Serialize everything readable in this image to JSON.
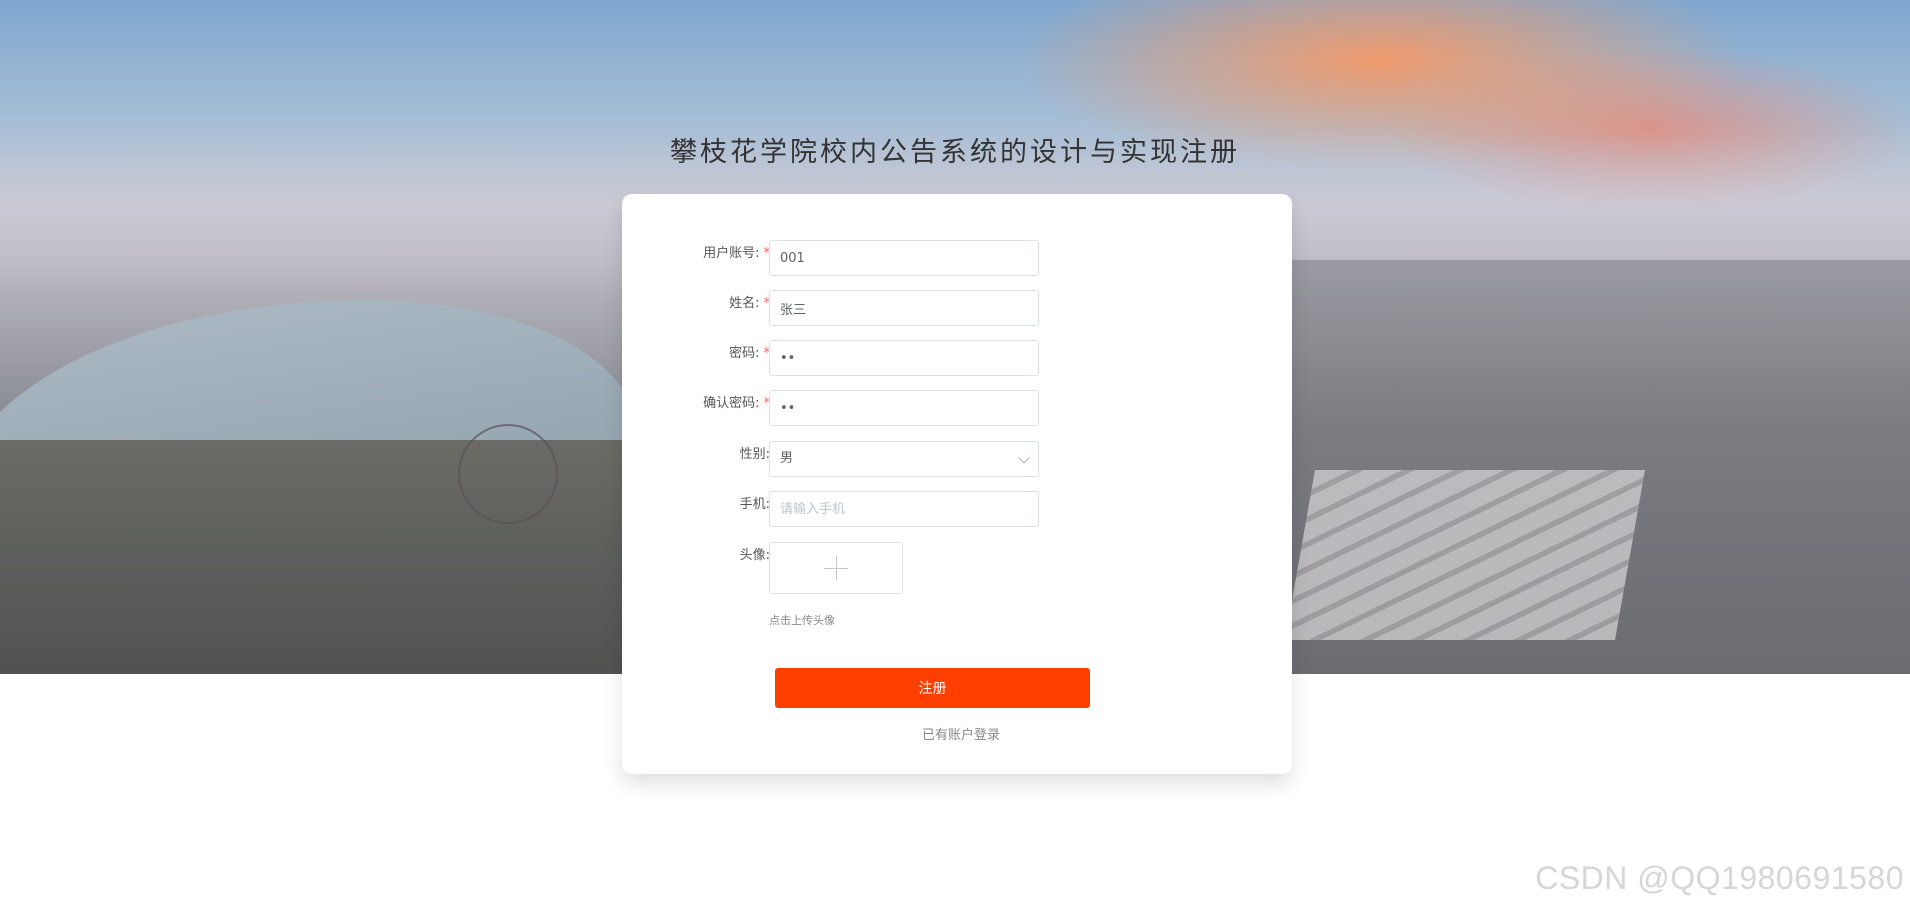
{
  "page": {
    "title": "攀枝花学院校内公告系统的设计与实现注册"
  },
  "form": {
    "fields": [
      {
        "label": "用户账号:",
        "required": true,
        "value": "001",
        "placeholder": ""
      },
      {
        "label": "姓名:",
        "required": true,
        "value": "张三",
        "placeholder": ""
      },
      {
        "label": "密码:",
        "required": true,
        "value": "••",
        "placeholder": ""
      },
      {
        "label": "确认密码:",
        "required": true,
        "value": "••",
        "placeholder": ""
      },
      {
        "label": "性别:",
        "required": false,
        "value": "男",
        "placeholder": ""
      },
      {
        "label": "手机:",
        "required": false,
        "value": "",
        "placeholder": "请输入手机"
      }
    ],
    "avatar": {
      "label": "头像:",
      "hint": "点击上传头像",
      "icon": "plus-icon"
    },
    "required_marker": "*",
    "submit_label": "注册",
    "login_link": "已有账户登录"
  },
  "watermark": "CSDN @QQ1980691580",
  "colors": {
    "primary_button": "#ff3f00",
    "required_marker": "#f56c6c",
    "card_bg": "#ffffff"
  }
}
